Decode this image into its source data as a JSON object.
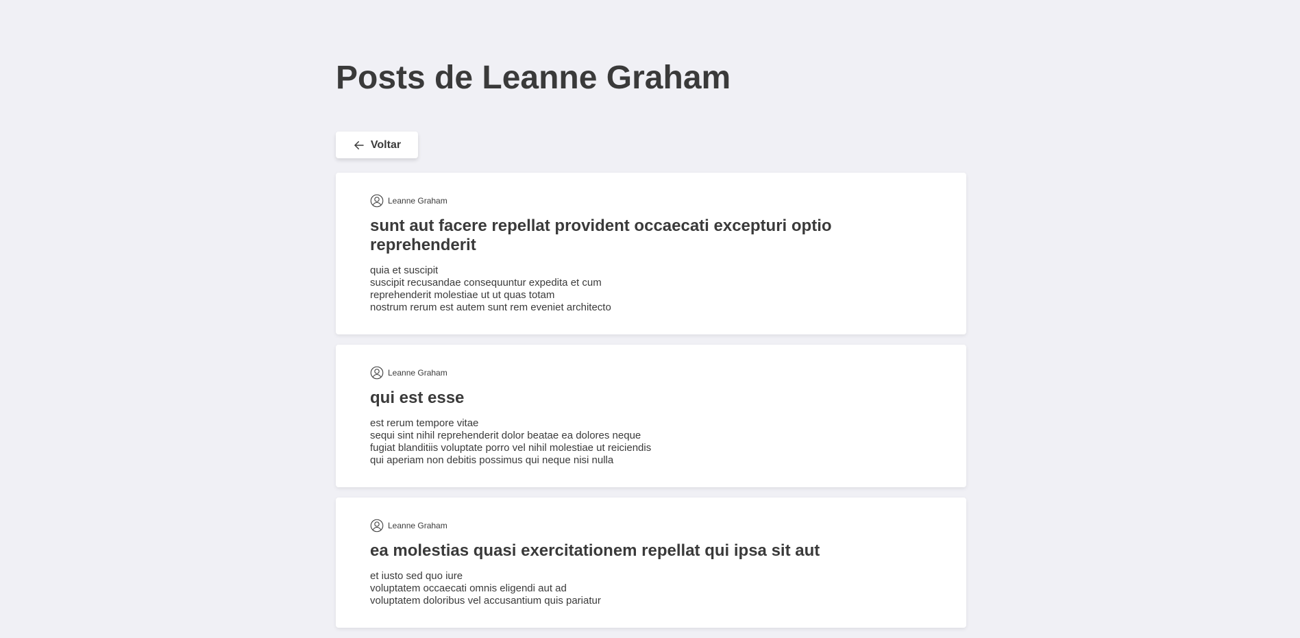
{
  "header": {
    "title": "Posts de Leanne Graham"
  },
  "toolbar": {
    "back_label": "Voltar",
    "back_icon": "arrow-left-icon"
  },
  "posts": [
    {
      "author": "Leanne Graham",
      "author_icon": "user-circle-icon",
      "title": "sunt aut facere repellat provident occaecati excepturi optio reprehenderit",
      "body": "quia et suscipit\nsuscipit recusandae consequuntur expedita et cum\nreprehenderit molestiae ut ut quas totam\nnostrum rerum est autem sunt rem eveniet architecto"
    },
    {
      "author": "Leanne Graham",
      "author_icon": "user-circle-icon",
      "title": "qui est esse",
      "body": "est rerum tempore vitae\nsequi sint nihil reprehenderit dolor beatae ea dolores neque\nfugiat blanditiis voluptate porro vel nihil molestiae ut reiciendis\nqui aperiam non debitis possimus qui neque nisi nulla"
    },
    {
      "author": "Leanne Graham",
      "author_icon": "user-circle-icon",
      "title": "ea molestias quasi exercitationem repellat qui ipsa sit aut",
      "body": "et iusto sed quo iure\nvoluptatem occaecati omnis eligendi aut ad\nvoluptatem doloribus vel accusantium quis pariatur"
    }
  ]
}
